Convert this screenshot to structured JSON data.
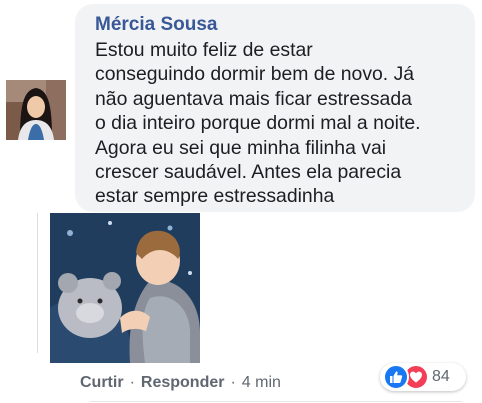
{
  "comment": {
    "author": "Mércia Sousa",
    "text": "Estou muito feliz de estar\nconseguindo dormir bem de novo. Já\nnão aguentava mais ficar estressada\no dia inteiro porque dormi mal a noite.\nAgora eu sei que minha filinha vai\ncrescer saudável. Antes ela parecia\nestar sempre estressadinha"
  },
  "actions": {
    "like_label": "Curtir",
    "separator": "·",
    "reply_label": "Responder",
    "time": "4 min"
  },
  "reactions": {
    "types": [
      "like",
      "love"
    ],
    "count": "84",
    "colors": {
      "like": "#1877f2",
      "love": "#f33e58"
    }
  },
  "colors": {
    "author_name": "#385898",
    "bubble_background": "#f2f3f5",
    "action_text": "#606770"
  }
}
